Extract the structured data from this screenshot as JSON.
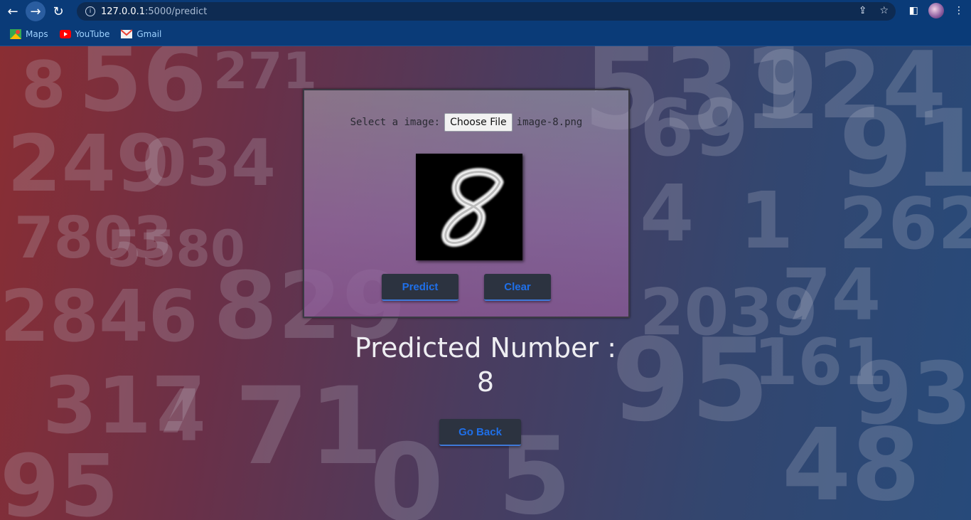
{
  "browser": {
    "url_host": "127.0.0.1",
    "url_path": ":5000/predict",
    "bookmarks": [
      {
        "label": "Maps",
        "icon": "maps-icon"
      },
      {
        "label": "YouTube",
        "icon": "youtube-icon"
      },
      {
        "label": "Gmail",
        "icon": "gmail-icon"
      }
    ]
  },
  "upload": {
    "label": "Select a image:",
    "button_label": "Choose File",
    "file_name": "image-8.png"
  },
  "actions": {
    "predict_label": "Predict",
    "clear_label": "Clear",
    "go_back_label": "Go Back"
  },
  "result": {
    "title": "Predicted Number :",
    "value": "8"
  },
  "colors": {
    "chrome": "#0a3b78",
    "button_bg": "#2c3340",
    "button_text": "#1f6fe8"
  }
}
